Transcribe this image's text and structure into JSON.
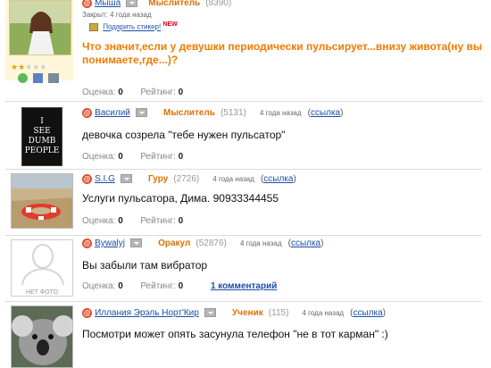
{
  "question": {
    "author": "Мыша",
    "rank": "Мыслитель",
    "points": "(8390)",
    "closed_text": "Закрыт: 4 года назад",
    "gift_label": "Подарить стикер!",
    "gift_badge": "NEW",
    "title": "Что значит,если у девушки периодически пульсирует...внизу живота(ну вы понимаете,где...)?",
    "score_label": "Оценка:",
    "score_value": "0",
    "rating_label": "Рейтинг:",
    "rating_value": "0",
    "stars_filled": 2,
    "stars_total": 5
  },
  "answers": [
    {
      "author": "Василий",
      "rank": "Мыслитель",
      "points": "(5131)",
      "time": "4 года назад",
      "link_label": "ссылка",
      "text": "девочка созрела \"тебе нужен пульсатор\"",
      "score_label": "Оценка:",
      "score_value": "0",
      "rating_label": "Рейтинг:",
      "rating_value": "0",
      "avatar_text": [
        "I",
        "SEE",
        "DUMB",
        "PEOPLE"
      ]
    },
    {
      "author": "S.I.G",
      "rank": "Гуру",
      "points": "(2726)",
      "time": "4 года назад",
      "link_label": "ссылка",
      "text": "Услуги пульсатора, Дима. 90933344455",
      "score_label": "Оценка:",
      "score_value": "0",
      "rating_label": "Рейтинг:",
      "rating_value": "0"
    },
    {
      "author": "Bywalyj",
      "rank": "Оракул",
      "points": "(52876)",
      "time": "4 года назад",
      "link_label": "ссылка",
      "text": "Вы забыли там вибратор",
      "score_label": "Оценка:",
      "score_value": "0",
      "rating_label": "Рейтинг:",
      "rating_value": "0",
      "comments_label": "1 комментарий",
      "avatar_caption": "НЕТ ФОТО"
    },
    {
      "author": "Иллания Эрэль Норт'Кир",
      "rank": "Ученик",
      "points": "(115)",
      "time": "4 года назад",
      "link_label": "ссылка",
      "text": "Посмотри может опять засунула телефон \"не в тот карман\" :)"
    }
  ]
}
